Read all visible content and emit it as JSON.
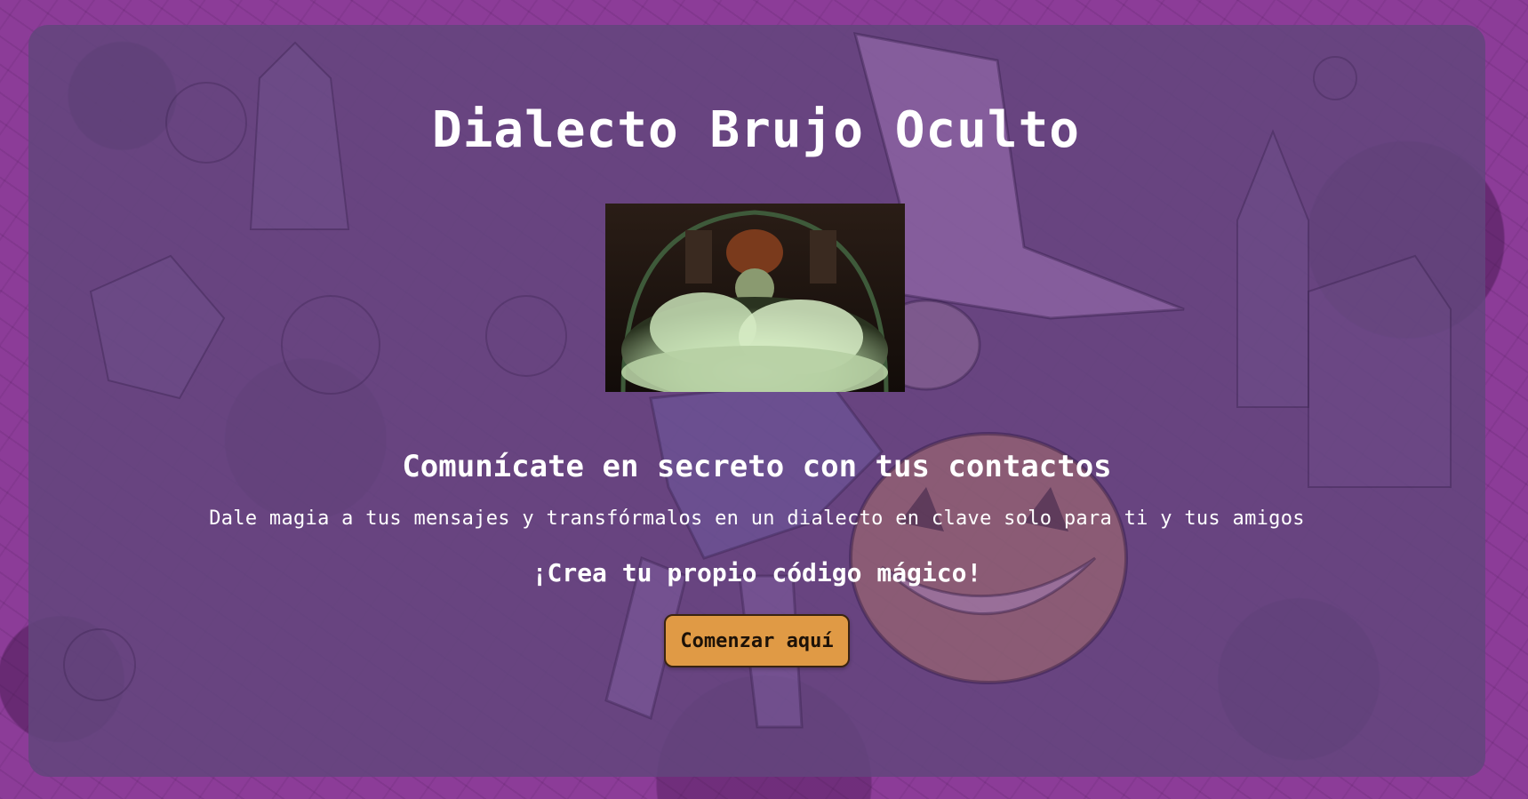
{
  "page": {
    "title": "Dialecto Brujo Oculto",
    "subtitle": "Comunícate en secreto con tus contactos",
    "description": "Dale magia a tus mensajes y transfórmalos en un dialecto en clave solo para ti y tus amigos",
    "cta_text": "¡Crea tu propio código mágico!",
    "start_button_label": "Comenzar aquí"
  },
  "colors": {
    "background": "#8c3c98",
    "panel": "#62467d",
    "button": "#e09a45",
    "text": "#ffffff"
  },
  "images": {
    "hero": "witch-cauldron-smoke-image",
    "background": "witch-illustration-pattern"
  }
}
